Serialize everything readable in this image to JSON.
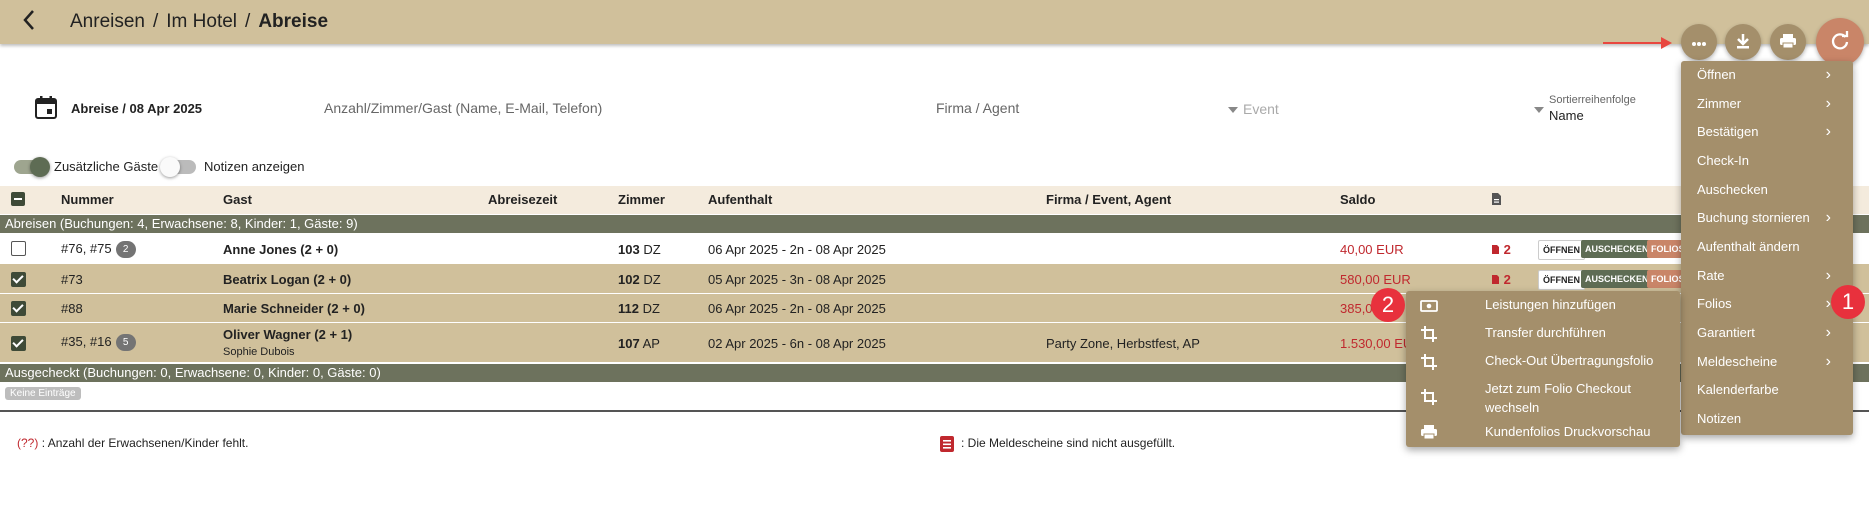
{
  "breadcrumb": {
    "part1": "Anreisen",
    "part2": "Im Hotel",
    "current": "Abreise",
    "sep": "/"
  },
  "header_actions": {
    "more": "more-vert-icon",
    "download": "download-icon",
    "print": "print-icon",
    "refresh": "refresh-icon"
  },
  "filters": {
    "date_label": "Abreise / 08 Apr 2025",
    "search_placeholder": "Anzahl/Zimmer/Gast (Name, E-Mail, Telefon)",
    "firma_placeholder": "Firma / Agent",
    "event_placeholder": "Event",
    "sort_label": "Sortierreihenfolge",
    "sort_value": "Name"
  },
  "toggles": [
    {
      "label": "Zusätzliche Gäste",
      "on": true
    },
    {
      "label": "Notizen anzeigen",
      "on": false
    }
  ],
  "columns": [
    "Nummer",
    "Gast",
    "Abreisezeit",
    "Zimmer",
    "Aufenthalt",
    "Firma / Event, Agent",
    "Saldo"
  ],
  "groups": {
    "abreisen": "Abreisen (Buchungen: 4, Erwachsene: 8, Kinder: 1, Gäste: 9)",
    "ausgecheckt": "Ausgecheckt (Buchungen: 0, Erwachsene: 0, Kinder: 0, Gäste: 0)",
    "empty": "Keine Einträge"
  },
  "rows": [
    {
      "number": "#76, #75",
      "badge": "2",
      "guest": "Anne Jones (2 + 0)",
      "sub": "",
      "room": "103",
      "type": "DZ",
      "stay": "06 Apr 2025 - 2n - 08 Apr 2025",
      "firma": "",
      "saldo": "40,00 EUR",
      "docs": "2",
      "checked": false
    },
    {
      "number": "#73",
      "badge": "",
      "guest": "Beatrix Logan (2 + 0)",
      "sub": "",
      "room": "102",
      "type": "DZ",
      "stay": "05 Apr 2025 - 3n - 08 Apr 2025",
      "firma": "",
      "saldo": "580,00 EUR",
      "docs": "2",
      "checked": true
    },
    {
      "number": "#88",
      "badge": "",
      "guest": "Marie Schneider (2 + 0)",
      "sub": "",
      "room": "112",
      "type": "DZ",
      "stay": "06 Apr 2025 - 2n - 08 Apr 2025",
      "firma": "",
      "saldo": "385,0",
      "docs": "",
      "checked": true
    },
    {
      "number": "#35, #16",
      "badge": "5",
      "guest": "Oliver Wagner (2 + 1)",
      "sub": "Sophie Dubois",
      "room": "107",
      "type": "AP",
      "stay": "02 Apr 2025 - 6n - 08 Apr 2025",
      "firma": "Party Zone, Herbstfest, AP",
      "saldo": "1.530,00 EUR",
      "docs": "",
      "checked": true
    }
  ],
  "row_buttons": {
    "open": "ÖFFNEN",
    "checkout": "AUSCHECKEN",
    "folios": "FOLIOS"
  },
  "legend": {
    "missing_code": "(??)",
    "missing_text": ": Anzahl der Erwachsenen/Kinder fehlt.",
    "forms_text": ": Die Meldescheine sind nicht ausgefüllt."
  },
  "main_menu": [
    {
      "label": "Öffnen",
      "sub": true
    },
    {
      "label": "Zimmer",
      "sub": true
    },
    {
      "label": "Bestätigen",
      "sub": true
    },
    {
      "label": "Check-In",
      "sub": false
    },
    {
      "label": "Auschecken",
      "sub": false
    },
    {
      "label": "Buchung stornieren",
      "sub": true
    },
    {
      "label": "Aufenthalt ändern",
      "sub": false
    },
    {
      "label": "Rate",
      "sub": true
    },
    {
      "label": "Folios",
      "sub": true
    },
    {
      "label": "Garantiert",
      "sub": true
    },
    {
      "label": "Meldescheine",
      "sub": true
    },
    {
      "label": "Kalenderfarbe",
      "sub": false
    },
    {
      "label": "Notizen",
      "sub": false
    }
  ],
  "folio_menu": [
    {
      "label": "Leistungen hinzufügen",
      "icon": "money-icon"
    },
    {
      "label": "Transfer durchführen",
      "icon": "crop-icon"
    },
    {
      "label": "Check-Out Übertragungsfolio",
      "icon": "crop-icon"
    },
    {
      "label": "Jetzt zum Folio Checkout wechseln",
      "icon": "crop-icon"
    },
    {
      "label": "Kundenfolios Druckvorschau",
      "icon": "print-icon"
    }
  ],
  "callouts": {
    "one": "1",
    "two": "2"
  },
  "colors": {
    "header": "#d0c09b",
    "menu": "#a48f6b",
    "group": "#6d725d",
    "accent": "#c98568",
    "negative": "#c0282e"
  }
}
